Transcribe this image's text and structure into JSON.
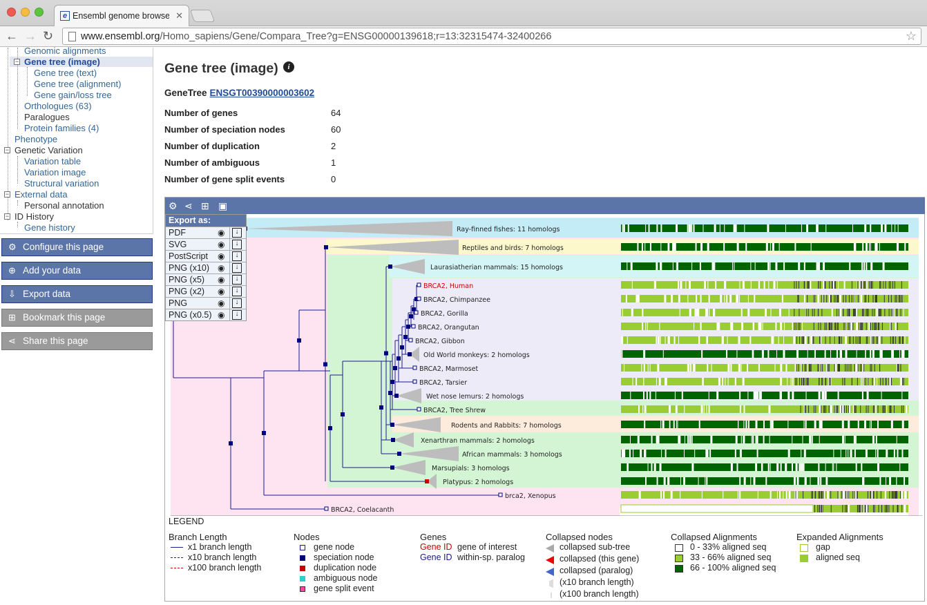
{
  "browser": {
    "tab_title": "Ensembl genome browser",
    "tab_favicon": "e",
    "url_host": "www.ensembl.org",
    "url_path": "/Homo_sapiens/Gene/Compara_Tree?g=ENSG00000139618;r=13:32315474-32400266"
  },
  "sidebar": {
    "items": [
      {
        "label": "Genomic alignments"
      },
      {
        "label": "Gene tree (image)"
      },
      {
        "label": "Gene tree (text)"
      },
      {
        "label": "Gene tree (alignment)"
      },
      {
        "label": "Gene gain/loss tree"
      },
      {
        "label": "Orthologues (63)"
      },
      {
        "label": "Paralogues"
      },
      {
        "label": "Protein families (4)"
      },
      {
        "label": "Phenotype"
      },
      {
        "label": "Genetic Variation"
      },
      {
        "label": "Variation table"
      },
      {
        "label": "Variation image"
      },
      {
        "label": "Structural variation"
      },
      {
        "label": "External data"
      },
      {
        "label": "Personal annotation"
      },
      {
        "label": "ID History"
      },
      {
        "label": "Gene history"
      }
    ],
    "buttons": [
      {
        "label": "Configure this page"
      },
      {
        "label": "Add your data"
      },
      {
        "label": "Export data"
      },
      {
        "label": "Bookmark this page"
      },
      {
        "label": "Share this page"
      }
    ]
  },
  "main": {
    "title": "Gene tree (image)",
    "genetree_label": "GeneTree",
    "genetree_id": "ENSGT00390000003602",
    "stats": [
      {
        "label": "Number of genes",
        "value": "64"
      },
      {
        "label": "Number of speciation nodes",
        "value": "60"
      },
      {
        "label": "Number of duplication",
        "value": "2"
      },
      {
        "label": "Number of ambiguous",
        "value": "1"
      },
      {
        "label": "Number of gene split events",
        "value": "0"
      }
    ]
  },
  "export_menu": {
    "title": "Export as:",
    "options": [
      "PDF",
      "SVG",
      "PostScript",
      "PNG (x10)",
      "PNG (x5)",
      "PNG (x2)",
      "PNG",
      "PNG (x0.5)"
    ]
  },
  "tree": {
    "leaves": [
      {
        "label": "Ray-finned fishes: 11 homologs"
      },
      {
        "label": "Reptiles and birds: 7 homologs"
      },
      {
        "label": "Laurasiatherian mammals: 15 homologs"
      },
      {
        "label": "BRCA2, Human"
      },
      {
        "label": "BRCA2, Chimpanzee"
      },
      {
        "label": "BRCA2, Gorilla"
      },
      {
        "label": "BRCA2, Orangutan"
      },
      {
        "label": "BRCA2, Gibbon"
      },
      {
        "label": "Old World monkeys: 2 homologs"
      },
      {
        "label": "BRCA2, Marmoset"
      },
      {
        "label": "BRCA2, Tarsier"
      },
      {
        "label": "Wet nose lemurs: 2 homologs"
      },
      {
        "label": "BRCA2, Tree Shrew"
      },
      {
        "label": "Rodents and Rabbits: 7 homologs"
      },
      {
        "label": "Xenarthran mammals: 2 homologs"
      },
      {
        "label": "African mammals: 3 homologs"
      },
      {
        "label": "Marsupials: 3 homologs"
      },
      {
        "label": "Platypus: 2 homologs"
      },
      {
        "label": "brca2, Xenopus"
      },
      {
        "label": "BRCA2, Coelacanth"
      }
    ]
  },
  "legend": {
    "title": "LEGEND",
    "branch": {
      "title": "Branch Length",
      "items": [
        "x1 branch length",
        "x10 branch length",
        "x100 branch length"
      ]
    },
    "nodes": {
      "title": "Nodes",
      "items": [
        "gene node",
        "speciation node",
        "duplication node",
        "ambiguous node",
        "gene split event"
      ]
    },
    "genes": {
      "title": "Genes",
      "tag": "Gene ID",
      "items": [
        "gene of interest",
        "within-sp. paralog"
      ]
    },
    "collapsed": {
      "title": "Collapsed nodes",
      "items": [
        "collapsed sub-tree",
        "collapsed (this gene)",
        "collapsed (paralog)",
        "(x10 branch length)",
        "(x100 branch length)"
      ]
    },
    "collapsed_al": {
      "title": "Collapsed Alignments",
      "items": [
        "0 - 33% aligned seq",
        "33 - 66% aligned seq",
        "66 - 100% aligned seq"
      ]
    },
    "expanded_al": {
      "title": "Expanded Alignments",
      "items": [
        "gap",
        "aligned seq"
      ]
    }
  },
  "colors": {
    "accent": "#5c75a9",
    "link": "#1f4b99",
    "dark_green": "#006400",
    "light_green": "#9acd32",
    "node_blue": "#000080",
    "dup_red": "#cc0000"
  }
}
